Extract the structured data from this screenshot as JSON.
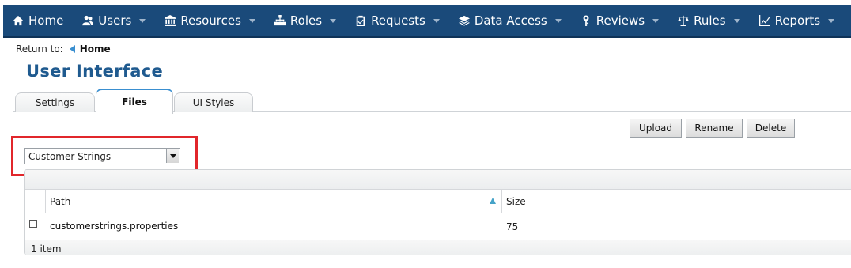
{
  "nav": {
    "items": [
      {
        "label": "Home",
        "icon": "home-icon",
        "caret": false
      },
      {
        "label": "Users",
        "icon": "users-icon",
        "caret": true
      },
      {
        "label": "Resources",
        "icon": "bank-icon",
        "caret": true
      },
      {
        "label": "Roles",
        "icon": "sitemap-icon",
        "caret": true
      },
      {
        "label": "Requests",
        "icon": "clipboard-check-icon",
        "caret": true
      },
      {
        "label": "Data Access",
        "icon": "layers-icon",
        "caret": true
      },
      {
        "label": "Reviews",
        "icon": "key-icon",
        "caret": true
      },
      {
        "label": "Rules",
        "icon": "scale-icon",
        "caret": true
      },
      {
        "label": "Reports",
        "icon": "chart-icon",
        "caret": true
      }
    ]
  },
  "breadcrumb": {
    "prefix": "Return to:",
    "link": "Home"
  },
  "page": {
    "title": "User Interface"
  },
  "tabs": [
    {
      "label": "Settings",
      "active": false
    },
    {
      "label": "Files",
      "active": true
    },
    {
      "label": "UI Styles",
      "active": false
    }
  ],
  "toolbar": {
    "upload": "Upload",
    "rename": "Rename",
    "delete": "Delete"
  },
  "file_select": {
    "value": "Customer Strings",
    "highlight_color": "#e1262b"
  },
  "grid": {
    "columns": {
      "path": "Path",
      "size": "Size"
    },
    "rows": [
      {
        "path": "customerstrings.properties",
        "size": "75"
      }
    ],
    "footer": "1 item"
  },
  "colors": {
    "nav_bg": "#1a4a7a",
    "title": "#1f5a8f",
    "accent": "#3a8fd0"
  }
}
